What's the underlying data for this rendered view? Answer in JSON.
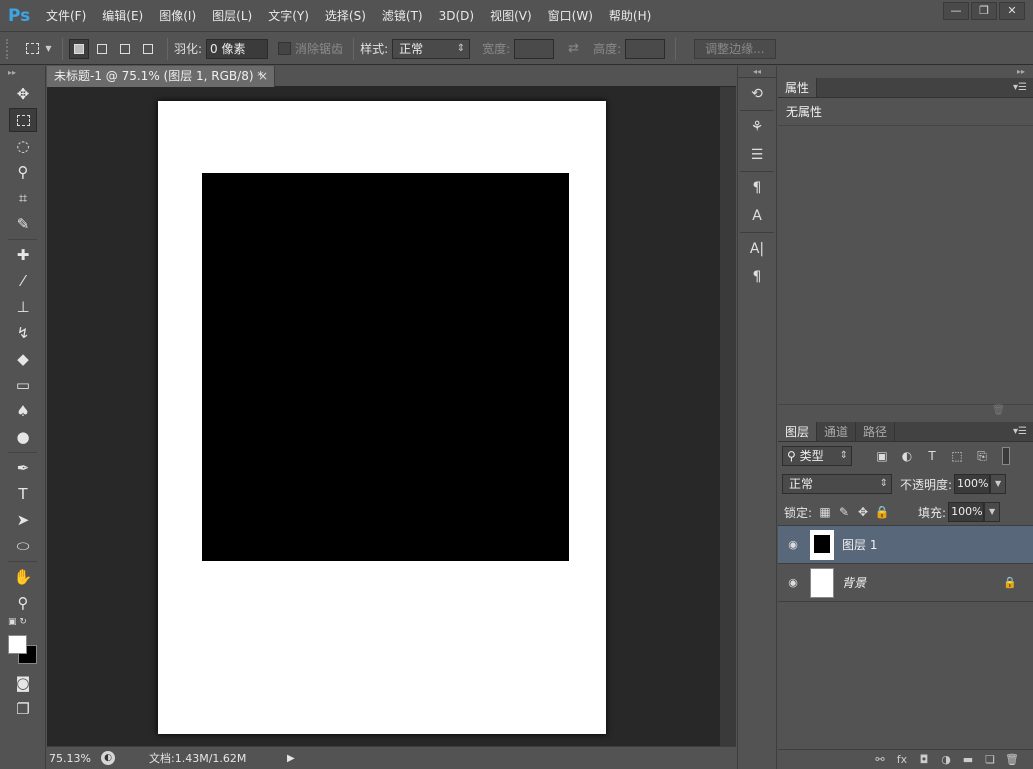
{
  "app": {
    "logo": "Ps"
  },
  "menu": [
    "文件(F)",
    "编辑(E)",
    "图像(I)",
    "图层(L)",
    "文字(Y)",
    "选择(S)",
    "滤镜(T)",
    "3D(D)",
    "视图(V)",
    "窗口(W)",
    "帮助(H)"
  ],
  "window_controls": {
    "minimize": "—",
    "restore": "❐",
    "close": "✕"
  },
  "options": {
    "feather_label": "羽化:",
    "feather_value": "0 像素",
    "antialias_label": "消除锯齿",
    "style_label": "样式:",
    "style_value": "正常",
    "width_label": "宽度:",
    "height_label": "高度:",
    "refine_edge": "调整边缘..."
  },
  "document": {
    "tab_title": "未标题-1 @ 75.1% (图层 1, RGB/8) *",
    "close": "×"
  },
  "status": {
    "zoom": "75.13%",
    "doc_size": "文档:1.43M/1.62M"
  },
  "properties": {
    "tab": "属性",
    "body": "无属性"
  },
  "layers_panel": {
    "tabs": [
      "图层",
      "通道",
      "路径"
    ],
    "filter_kind": "类型",
    "blend_mode": "正常",
    "opacity_label": "不透明度:",
    "opacity_value": "100%",
    "lock_label": "锁定:",
    "fill_label": "填充:",
    "fill_value": "100%",
    "layers": [
      {
        "name": "图层 1",
        "selected": true
      },
      {
        "name": "背景",
        "locked": true
      }
    ]
  }
}
